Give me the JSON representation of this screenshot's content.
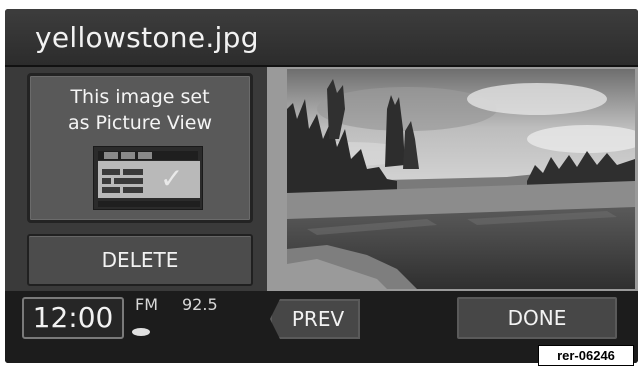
{
  "title_bar": {
    "file_name": "yellowstone.jpg"
  },
  "info_panel": {
    "message_lines": [
      "This image set",
      "as Picture View"
    ],
    "icon": "picture-view-icon"
  },
  "actions": {
    "delete_label": "DELETE",
    "prev_label": "PREV",
    "done_label": "DONE"
  },
  "status_bar": {
    "clock": "12:00",
    "band": "FM",
    "frequency": "92.5",
    "source_icon": "disc-icon"
  },
  "photo": {
    "icon": "landscape-photo"
  },
  "reference_tag": "rer-06246",
  "colors": {
    "screen_bg": "#1d1d1d",
    "panel_bg": "#3a3a3a",
    "button_bg": "#474747",
    "text": "#f2f2f2"
  }
}
